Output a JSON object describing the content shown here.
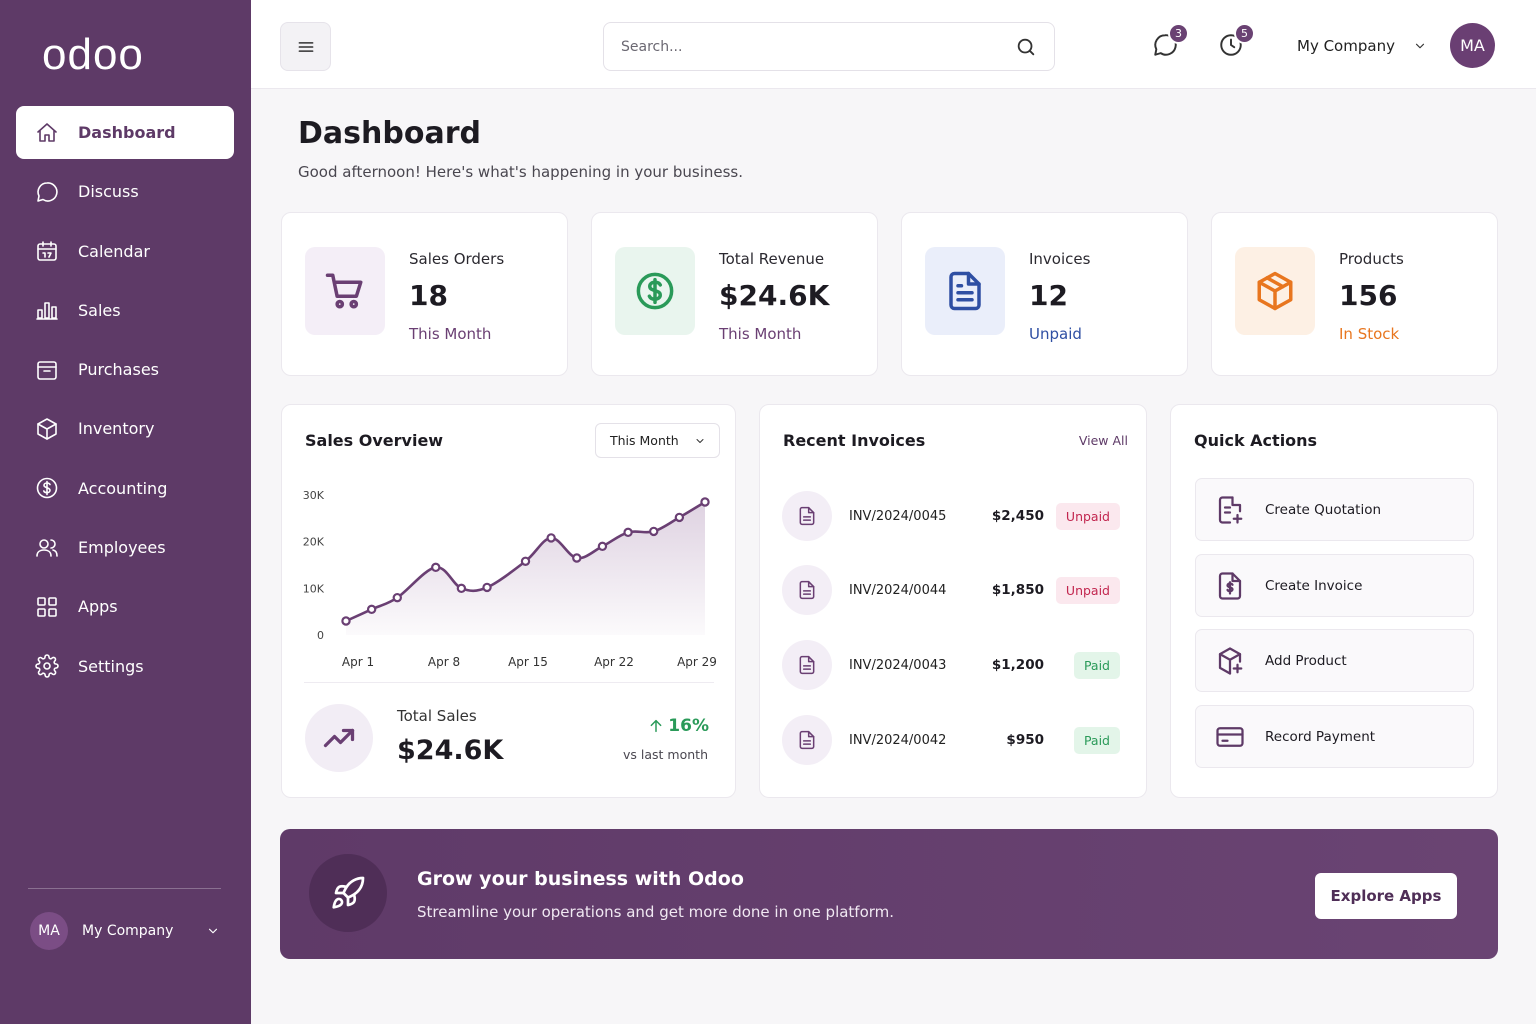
{
  "sidebar": {
    "logo": "odoo",
    "items": [
      {
        "label": "Dashboard",
        "icon": "home-icon"
      },
      {
        "label": "Discuss",
        "icon": "chat-icon"
      },
      {
        "label": "Calendar",
        "icon": "calendar-icon"
      },
      {
        "label": "Sales",
        "icon": "bar-chart-icon"
      },
      {
        "label": "Purchases",
        "icon": "purchase-icon"
      },
      {
        "label": "Inventory",
        "icon": "box-icon"
      },
      {
        "label": "Accounting",
        "icon": "dollar-icon"
      },
      {
        "label": "Employees",
        "icon": "users-icon"
      },
      {
        "label": "Apps",
        "icon": "grid-icon"
      },
      {
        "label": "Settings",
        "icon": "gear-icon"
      }
    ],
    "active_index": 0,
    "company": {
      "initials": "MA",
      "name": "My Company"
    }
  },
  "topbar": {
    "search_placeholder": "Search...",
    "messages_badge": "3",
    "activities_badge": "5",
    "company": "My Company",
    "avatar": "MA"
  },
  "header": {
    "title": "Dashboard",
    "subtitle": "Good afternoon! Here's what's happening in your business."
  },
  "stats": [
    {
      "label": "Sales Orders",
      "value": "18",
      "sub": "This Month",
      "color": "#6a3f73"
    },
    {
      "label": "Total Revenue",
      "value": "$24.6K",
      "sub": "This Month",
      "color": "#6a3f73"
    },
    {
      "label": "Invoices",
      "value": "12",
      "sub": "Unpaid",
      "color": "#2f4fa3"
    },
    {
      "label": "Products",
      "value": "156",
      "sub": "In Stock",
      "color": "#e8761f"
    }
  ],
  "sales_overview": {
    "title": "Sales Overview",
    "period": "This Month",
    "total_label": "Total Sales",
    "total_value": "$24.6K",
    "change": "16%",
    "change_note": "vs last month"
  },
  "chart_data": {
    "type": "area",
    "x_tick_labels": [
      "Apr 1",
      "Apr 8",
      "Apr 15",
      "Apr 22",
      "Apr 29"
    ],
    "y_tick_labels": [
      "0",
      "10K",
      "20K",
      "30K"
    ],
    "ylim": [
      0,
      30000
    ],
    "series": [
      {
        "day": [
          1,
          3,
          5,
          8,
          10,
          12,
          15,
          17,
          19,
          21,
          23,
          25,
          27,
          29
        ],
        "values": [
          3000,
          5500,
          8000,
          14500,
          10000,
          10200,
          15800,
          20800,
          16500,
          19000,
          22000,
          22200,
          25200,
          28500
        ]
      }
    ],
    "grid": false,
    "color": "#6a3f73"
  },
  "recent_invoices": {
    "title": "Recent Invoices",
    "view_all": "View All",
    "rows": [
      {
        "number": "INV/2024/0045",
        "amount": "$2,450",
        "status": "Unpaid"
      },
      {
        "number": "INV/2024/0044",
        "amount": "$1,850",
        "status": "Unpaid"
      },
      {
        "number": "INV/2024/0043",
        "amount": "$1,200",
        "status": "Paid"
      },
      {
        "number": "INV/2024/0042",
        "amount": "$950",
        "status": "Paid"
      }
    ]
  },
  "quick_actions": {
    "title": "Quick Actions",
    "items": [
      {
        "label": "Create Quotation",
        "icon": "quotation-icon"
      },
      {
        "label": "Create Invoice",
        "icon": "invoice-icon"
      },
      {
        "label": "Add Product",
        "icon": "add-product-icon"
      },
      {
        "label": "Record Payment",
        "icon": "payment-icon"
      }
    ]
  },
  "banner": {
    "title": "Grow your business with Odoo",
    "subtitle": "Streamline your operations and get more done in one platform.",
    "button": "Explore Apps"
  }
}
